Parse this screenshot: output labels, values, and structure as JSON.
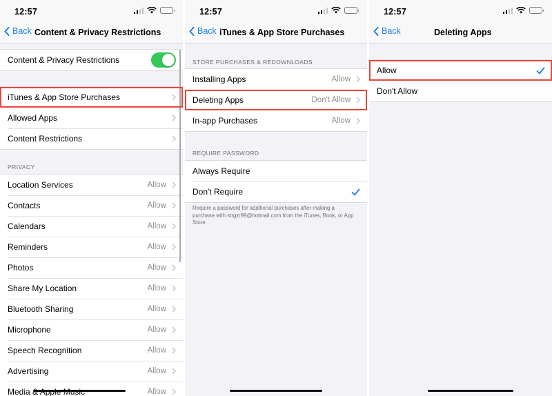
{
  "status": {
    "time": "12:57"
  },
  "screen1": {
    "back": "Back",
    "title": "Content & Privacy Restrictions",
    "toggle_row": {
      "label": "Content & Privacy Restrictions",
      "on": true
    },
    "nav_items": [
      {
        "label": "iTunes & App Store Purchases",
        "highlighted": true
      },
      {
        "label": "Allowed Apps"
      },
      {
        "label": "Content Restrictions"
      }
    ],
    "privacy_header": "PRIVACY",
    "privacy_items": [
      {
        "label": "Location Services",
        "value": "Allow"
      },
      {
        "label": "Contacts",
        "value": "Allow"
      },
      {
        "label": "Calendars",
        "value": "Allow"
      },
      {
        "label": "Reminders",
        "value": "Allow"
      },
      {
        "label": "Photos",
        "value": "Allow"
      },
      {
        "label": "Share My Location",
        "value": "Allow"
      },
      {
        "label": "Bluetooth Sharing",
        "value": "Allow"
      },
      {
        "label": "Microphone",
        "value": "Allow"
      },
      {
        "label": "Speech Recognition",
        "value": "Allow"
      },
      {
        "label": "Advertising",
        "value": "Allow"
      },
      {
        "label": "Media & Apple Music",
        "value": "Allow"
      }
    ]
  },
  "screen2": {
    "back": "Back",
    "title": "iTunes & App Store Purchases",
    "store_header": "STORE PURCHASES & REDOWNLOADS",
    "store_items": [
      {
        "label": "Installing Apps",
        "value": "Allow"
      },
      {
        "label": "Deleting Apps",
        "value": "Don't Allow",
        "highlighted": true
      },
      {
        "label": "In-app Purchases",
        "value": "Allow"
      }
    ],
    "password_header": "REQUIRE PASSWORD",
    "password_items": [
      {
        "label": "Always Require",
        "checked": false
      },
      {
        "label": "Don't Require",
        "checked": true
      }
    ],
    "footer": "Require a password for additional purchases after making a purchase with strgzr99@hotmail.com from the iTunes, Book, or App Store."
  },
  "screen3": {
    "back": "Back",
    "title": "Deleting Apps",
    "options": [
      {
        "label": "Allow",
        "checked": true,
        "highlighted": true
      },
      {
        "label": "Don't Allow",
        "checked": false
      }
    ]
  },
  "colors": {
    "accent": "#1b7fe3",
    "highlight": "#e8463a",
    "toggle_on": "#34c759",
    "secondary_text": "#8e8e93"
  }
}
